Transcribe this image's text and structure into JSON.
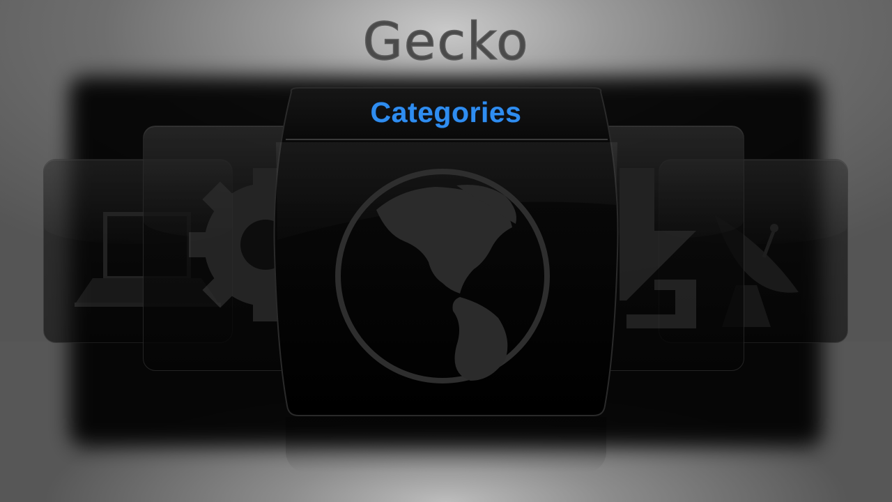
{
  "app": {
    "logo_text": "Gecko"
  },
  "carousel": {
    "selected_label": "Categories",
    "items": [
      {
        "icon": "laptop-icon",
        "position": "far-left"
      },
      {
        "icon": "gear-icon",
        "position": "near-left"
      },
      {
        "icon": "globe-icon",
        "position": "center",
        "label": "Categories"
      },
      {
        "icon": "puzzle-icon",
        "position": "near-right"
      },
      {
        "icon": "satellite-dish-icon",
        "position": "far-right"
      }
    ]
  },
  "colors": {
    "accent": "#2f8df0",
    "logo": "#4a4a4a"
  }
}
